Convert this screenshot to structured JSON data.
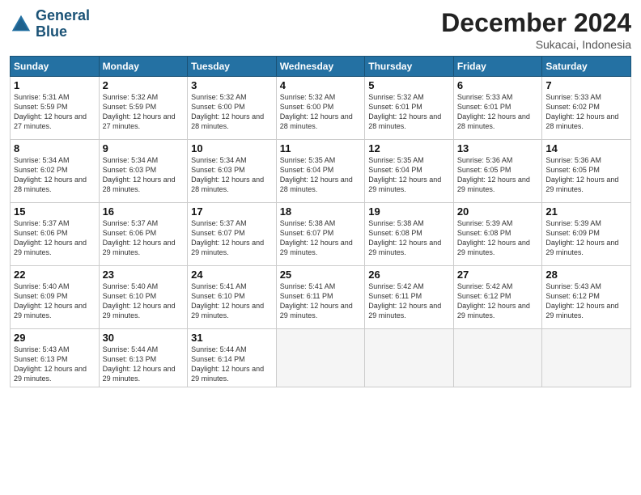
{
  "header": {
    "logo_line1": "General",
    "logo_line2": "Blue",
    "month": "December 2024",
    "location": "Sukacai, Indonesia"
  },
  "weekdays": [
    "Sunday",
    "Monday",
    "Tuesday",
    "Wednesday",
    "Thursday",
    "Friday",
    "Saturday"
  ],
  "weeks": [
    [
      {
        "day": "1",
        "sunrise": "Sunrise: 5:31 AM",
        "sunset": "Sunset: 5:59 PM",
        "daylight": "Daylight: 12 hours and 27 minutes."
      },
      {
        "day": "2",
        "sunrise": "Sunrise: 5:32 AM",
        "sunset": "Sunset: 5:59 PM",
        "daylight": "Daylight: 12 hours and 27 minutes."
      },
      {
        "day": "3",
        "sunrise": "Sunrise: 5:32 AM",
        "sunset": "Sunset: 6:00 PM",
        "daylight": "Daylight: 12 hours and 28 minutes."
      },
      {
        "day": "4",
        "sunrise": "Sunrise: 5:32 AM",
        "sunset": "Sunset: 6:00 PM",
        "daylight": "Daylight: 12 hours and 28 minutes."
      },
      {
        "day": "5",
        "sunrise": "Sunrise: 5:32 AM",
        "sunset": "Sunset: 6:01 PM",
        "daylight": "Daylight: 12 hours and 28 minutes."
      },
      {
        "day": "6",
        "sunrise": "Sunrise: 5:33 AM",
        "sunset": "Sunset: 6:01 PM",
        "daylight": "Daylight: 12 hours and 28 minutes."
      },
      {
        "day": "7",
        "sunrise": "Sunrise: 5:33 AM",
        "sunset": "Sunset: 6:02 PM",
        "daylight": "Daylight: 12 hours and 28 minutes."
      }
    ],
    [
      {
        "day": "8",
        "sunrise": "Sunrise: 5:34 AM",
        "sunset": "Sunset: 6:02 PM",
        "daylight": "Daylight: 12 hours and 28 minutes."
      },
      {
        "day": "9",
        "sunrise": "Sunrise: 5:34 AM",
        "sunset": "Sunset: 6:03 PM",
        "daylight": "Daylight: 12 hours and 28 minutes."
      },
      {
        "day": "10",
        "sunrise": "Sunrise: 5:34 AM",
        "sunset": "Sunset: 6:03 PM",
        "daylight": "Daylight: 12 hours and 28 minutes."
      },
      {
        "day": "11",
        "sunrise": "Sunrise: 5:35 AM",
        "sunset": "Sunset: 6:04 PM",
        "daylight": "Daylight: 12 hours and 28 minutes."
      },
      {
        "day": "12",
        "sunrise": "Sunrise: 5:35 AM",
        "sunset": "Sunset: 6:04 PM",
        "daylight": "Daylight: 12 hours and 29 minutes."
      },
      {
        "day": "13",
        "sunrise": "Sunrise: 5:36 AM",
        "sunset": "Sunset: 6:05 PM",
        "daylight": "Daylight: 12 hours and 29 minutes."
      },
      {
        "day": "14",
        "sunrise": "Sunrise: 5:36 AM",
        "sunset": "Sunset: 6:05 PM",
        "daylight": "Daylight: 12 hours and 29 minutes."
      }
    ],
    [
      {
        "day": "15",
        "sunrise": "Sunrise: 5:37 AM",
        "sunset": "Sunset: 6:06 PM",
        "daylight": "Daylight: 12 hours and 29 minutes."
      },
      {
        "day": "16",
        "sunrise": "Sunrise: 5:37 AM",
        "sunset": "Sunset: 6:06 PM",
        "daylight": "Daylight: 12 hours and 29 minutes."
      },
      {
        "day": "17",
        "sunrise": "Sunrise: 5:37 AM",
        "sunset": "Sunset: 6:07 PM",
        "daylight": "Daylight: 12 hours and 29 minutes."
      },
      {
        "day": "18",
        "sunrise": "Sunrise: 5:38 AM",
        "sunset": "Sunset: 6:07 PM",
        "daylight": "Daylight: 12 hours and 29 minutes."
      },
      {
        "day": "19",
        "sunrise": "Sunrise: 5:38 AM",
        "sunset": "Sunset: 6:08 PM",
        "daylight": "Daylight: 12 hours and 29 minutes."
      },
      {
        "day": "20",
        "sunrise": "Sunrise: 5:39 AM",
        "sunset": "Sunset: 6:08 PM",
        "daylight": "Daylight: 12 hours and 29 minutes."
      },
      {
        "day": "21",
        "sunrise": "Sunrise: 5:39 AM",
        "sunset": "Sunset: 6:09 PM",
        "daylight": "Daylight: 12 hours and 29 minutes."
      }
    ],
    [
      {
        "day": "22",
        "sunrise": "Sunrise: 5:40 AM",
        "sunset": "Sunset: 6:09 PM",
        "daylight": "Daylight: 12 hours and 29 minutes."
      },
      {
        "day": "23",
        "sunrise": "Sunrise: 5:40 AM",
        "sunset": "Sunset: 6:10 PM",
        "daylight": "Daylight: 12 hours and 29 minutes."
      },
      {
        "day": "24",
        "sunrise": "Sunrise: 5:41 AM",
        "sunset": "Sunset: 6:10 PM",
        "daylight": "Daylight: 12 hours and 29 minutes."
      },
      {
        "day": "25",
        "sunrise": "Sunrise: 5:41 AM",
        "sunset": "Sunset: 6:11 PM",
        "daylight": "Daylight: 12 hours and 29 minutes."
      },
      {
        "day": "26",
        "sunrise": "Sunrise: 5:42 AM",
        "sunset": "Sunset: 6:11 PM",
        "daylight": "Daylight: 12 hours and 29 minutes."
      },
      {
        "day": "27",
        "sunrise": "Sunrise: 5:42 AM",
        "sunset": "Sunset: 6:12 PM",
        "daylight": "Daylight: 12 hours and 29 minutes."
      },
      {
        "day": "28",
        "sunrise": "Sunrise: 5:43 AM",
        "sunset": "Sunset: 6:12 PM",
        "daylight": "Daylight: 12 hours and 29 minutes."
      }
    ],
    [
      {
        "day": "29",
        "sunrise": "Sunrise: 5:43 AM",
        "sunset": "Sunset: 6:13 PM",
        "daylight": "Daylight: 12 hours and 29 minutes."
      },
      {
        "day": "30",
        "sunrise": "Sunrise: 5:44 AM",
        "sunset": "Sunset: 6:13 PM",
        "daylight": "Daylight: 12 hours and 29 minutes."
      },
      {
        "day": "31",
        "sunrise": "Sunrise: 5:44 AM",
        "sunset": "Sunset: 6:14 PM",
        "daylight": "Daylight: 12 hours and 29 minutes."
      },
      null,
      null,
      null,
      null
    ]
  ]
}
